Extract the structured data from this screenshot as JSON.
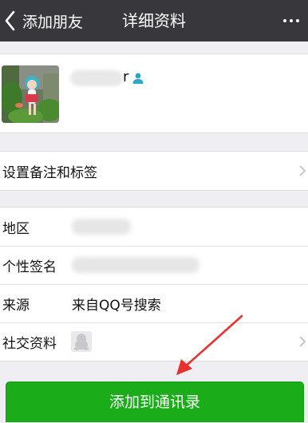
{
  "navbar": {
    "back_label": "添加朋友",
    "title": "详细资料",
    "more_icon": "more-dots-icon"
  },
  "profile": {
    "nickname_visible_suffix": "r",
    "verified_icon": "person-icon",
    "accent_color": "#2aa7c9"
  },
  "remark_row": {
    "label": "设置备注和标签"
  },
  "info_rows": [
    {
      "label": "地区",
      "value": ""
    },
    {
      "label": "个性签名",
      "value": ""
    },
    {
      "label": "来源",
      "value": "来自QQ号搜索"
    },
    {
      "label": "社交资料",
      "value": ""
    }
  ],
  "add_button": {
    "label": "添加到通讯录",
    "color": "#1aad19"
  },
  "annotation": {
    "arrow_color": "#e8322d"
  }
}
